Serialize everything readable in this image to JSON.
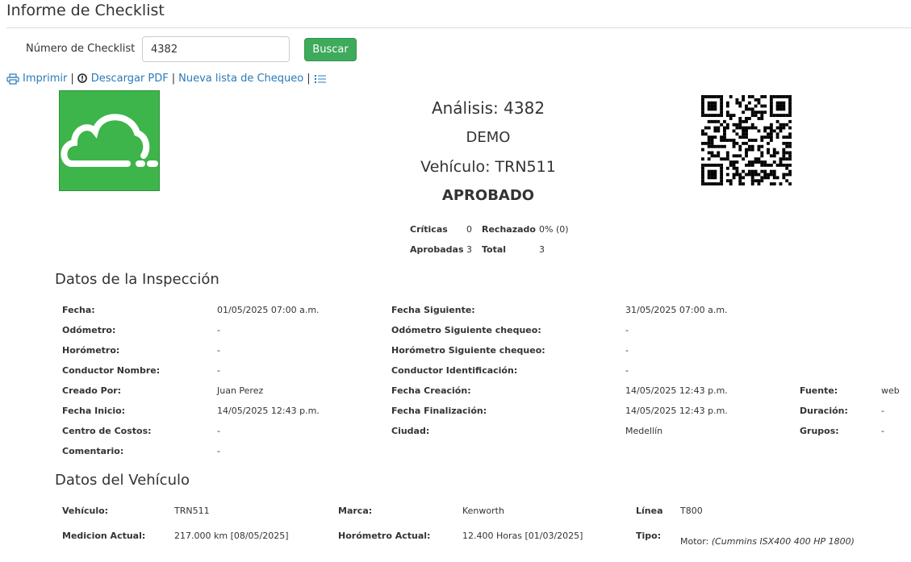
{
  "header": {
    "title": "Informe de Checklist"
  },
  "search": {
    "label": "Número de Checklist",
    "value": "4382",
    "button": "Buscar"
  },
  "actions": {
    "print": "Imprimir",
    "pdf": "Descargar PDF",
    "new_list": "Nueva lista de Chequeo",
    "separator": "|"
  },
  "report": {
    "analysis": "Análisis: 4382",
    "company": "DEMO",
    "vehicle": "Vehículo: TRN511",
    "status": "APROBADO"
  },
  "summary": {
    "criticas_label": "Críticas",
    "criticas_value": "0",
    "rechazado_label": "Rechazado",
    "rechazado_value": "0% (0)",
    "aprobadas_label": "Aprobadas",
    "aprobadas_value": "3",
    "total_label": "Total",
    "total_value": "3"
  },
  "inspection": {
    "title": "Datos de la Inspección",
    "fecha_label": "Fecha:",
    "fecha": "01/05/2025 07:00 a.m.",
    "fecha_sig_label": "Fecha Siguiente:",
    "fecha_sig": "31/05/2025 07:00 a.m.",
    "odometro_label": "Odómetro:",
    "odometro": "-",
    "odometro_sig_label": "Odómetro Siguiente chequeo:",
    "odometro_sig": "-",
    "horometro_label": "Horómetro:",
    "horometro": "-",
    "horometro_sig_label": "Horómetro Siguiente chequeo:",
    "horometro_sig": "-",
    "conductor_label": "Conductor Nombre:",
    "conductor": "-",
    "conductor_id_label": "Conductor Identificación:",
    "conductor_id": "-",
    "creado_label": "Creado Por:",
    "creado": "Juan Perez",
    "fecha_creacion_label": "Fecha Creación:",
    "fecha_creacion": "14/05/2025 12:43 p.m.",
    "fuente_label": "Fuente:",
    "fuente": "web",
    "fecha_inicio_label": "Fecha Inicio:",
    "fecha_inicio": "14/05/2025 12:43 p.m.",
    "fecha_fin_label": "Fecha Finalización:",
    "fecha_fin": "14/05/2025 12:43 p.m.",
    "duracion_label": "Duración:",
    "duracion": "-",
    "centro_label": "Centro de Costos:",
    "centro": "-",
    "ciudad_label": "Ciudad:",
    "ciudad": "Medellín",
    "grupos_label": "Grupos:",
    "grupos": "-",
    "comentario_label": "Comentario:",
    "comentario": "-"
  },
  "vehicle_data": {
    "title": "Datos del Vehículo",
    "vehiculo_label": "Vehículo:",
    "vehiculo": "TRN511",
    "marca_label": "Marca:",
    "marca": "Kenworth",
    "linea_label": "Línea",
    "linea": "T800",
    "medicion_label": "Medicion Actual:",
    "medicion": "217.000 km [08/05/2025]",
    "horometro_label": "Horómetro Actual:",
    "horometro": "12.400 Horas [01/03/2025]",
    "tipo_label": "Tipo:",
    "motor_label": "Motor:",
    "motor_value": "(Cummins ISX400 400 HP 1800)"
  },
  "colors": {
    "accent": "#3daa5c",
    "logo": "#3db54a",
    "link": "#2a7ab8"
  },
  "icons": {
    "print": "printer-icon",
    "pdf": "alert-circle-icon",
    "list": "list-icon",
    "logo": "cloud-icon",
    "qr": "qr-code-icon"
  }
}
